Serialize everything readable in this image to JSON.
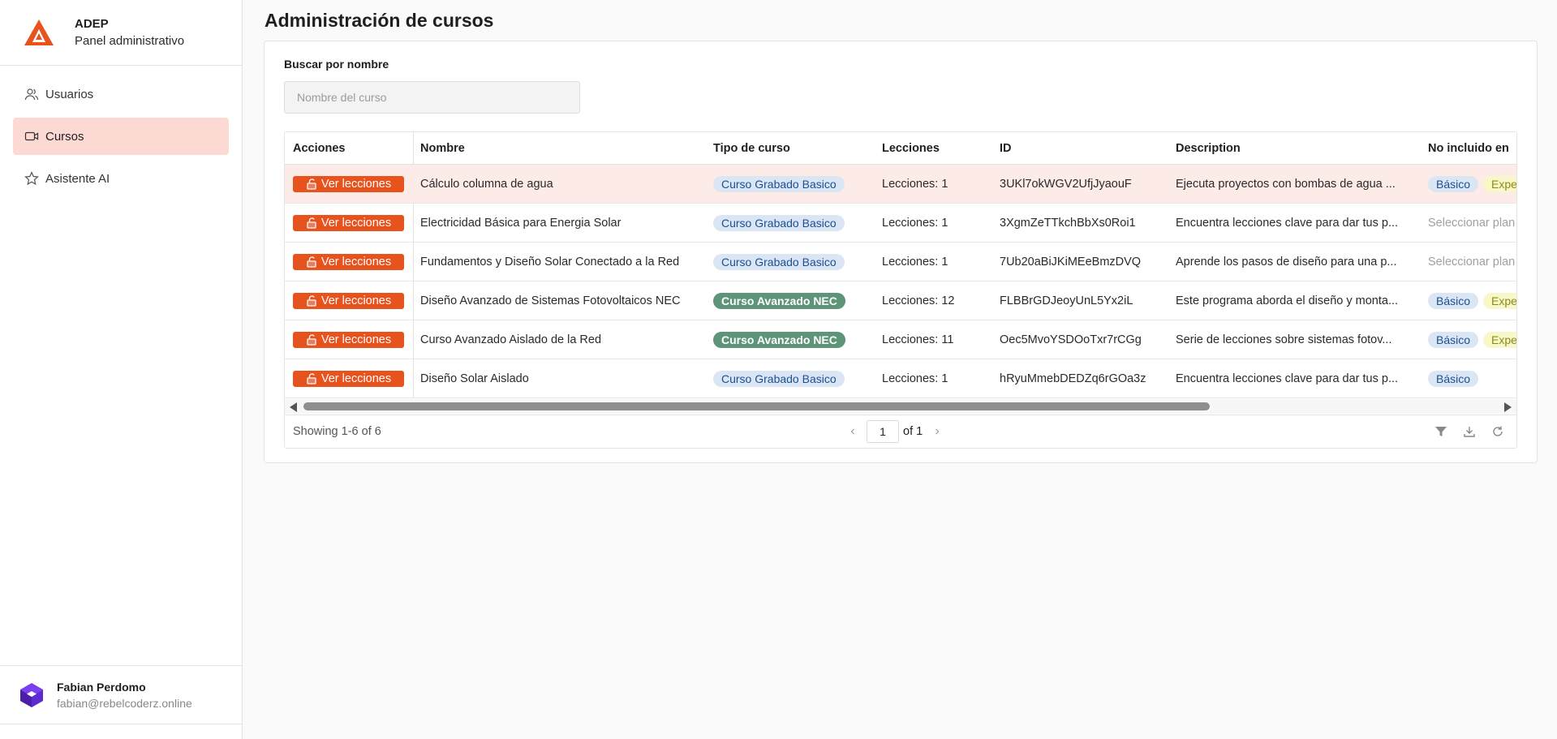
{
  "brand": {
    "name": "ADEP",
    "subtitle": "Panel administrativo",
    "accent": "#e8521c"
  },
  "sidebar": {
    "items": [
      {
        "label": "Usuarios",
        "icon": "users-icon",
        "active": false
      },
      {
        "label": "Cursos",
        "icon": "video-icon",
        "active": true
      },
      {
        "label": "Asistente AI",
        "icon": "star-icon",
        "active": false
      }
    ]
  },
  "user": {
    "name": "Fabian Perdomo",
    "email": "fabian@rebelcoderz.online"
  },
  "page": {
    "title": "Administración de cursos"
  },
  "search": {
    "label": "Buscar por nombre",
    "placeholder": "Nombre del curso",
    "value": ""
  },
  "table": {
    "columns": [
      "Acciones",
      "Nombre",
      "Tipo de curso",
      "Lecciones",
      "ID",
      "Description",
      "No incluido en"
    ],
    "action_label": "Ver lecciones",
    "rows": [
      {
        "nombre": "Cálculo columna de agua",
        "tipo": "Curso Grabado Basico",
        "tipo_style": "blue",
        "lecciones": "Lecciones: 1",
        "id": "3UKl7okWGV2UfjJyaouF",
        "description": "Ejecuta proyectos con bombas de agua ...",
        "plan1": "Básico",
        "plan2": "Expe"
      },
      {
        "nombre": "Electricidad Básica para Energia Solar",
        "tipo": "Curso Grabado Basico",
        "tipo_style": "blue",
        "lecciones": "Lecciones: 1",
        "id": "3XgmZeTTkchBbXs0Roi1",
        "description": "Encuentra lecciones clave para dar tus p...",
        "plan1": "",
        "plan2": "",
        "plan_placeholder": "Seleccionar plan"
      },
      {
        "nombre": "Fundamentos y Diseño Solar Conectado a la Red",
        "tipo": "Curso Grabado Basico",
        "tipo_style": "blue",
        "lecciones": "Lecciones: 1",
        "id": "7Ub20aBiJKiMEeBmzDVQ",
        "description": "Aprende los pasos de diseño para una p...",
        "plan1": "",
        "plan2": "",
        "plan_placeholder": "Seleccionar plan"
      },
      {
        "nombre": "Diseño Avanzado de Sistemas Fotovoltaicos NEC",
        "tipo": "Curso Avanzado NEC",
        "tipo_style": "green",
        "lecciones": "Lecciones: 12",
        "id": "FLBBrGDJeoyUnL5Yx2iL",
        "description": "Este programa aborda el diseño y monta...",
        "plan1": "Básico",
        "plan2": "Expe"
      },
      {
        "nombre": "Curso Avanzado Aislado de la Red",
        "tipo": "Curso Avanzado NEC",
        "tipo_style": "green",
        "lecciones": "Lecciones: 11",
        "id": "Oec5MvoYSDOoTxr7rCGg",
        "description": "Serie de lecciones sobre sistemas fotov...",
        "plan1": "Básico",
        "plan2": "Expe"
      },
      {
        "nombre": "Diseño Solar Aislado",
        "tipo": "Curso Grabado Basico",
        "tipo_style": "blue",
        "lecciones": "Lecciones: 1",
        "id": "hRyuMmebDEDZq6rGOa3z",
        "description": "Encuentra lecciones clave para dar tus p...",
        "plan1": "Básico",
        "plan2": ""
      }
    ]
  },
  "footer": {
    "showing": "Showing 1-6 of 6",
    "page": "1",
    "of": "of 1"
  }
}
